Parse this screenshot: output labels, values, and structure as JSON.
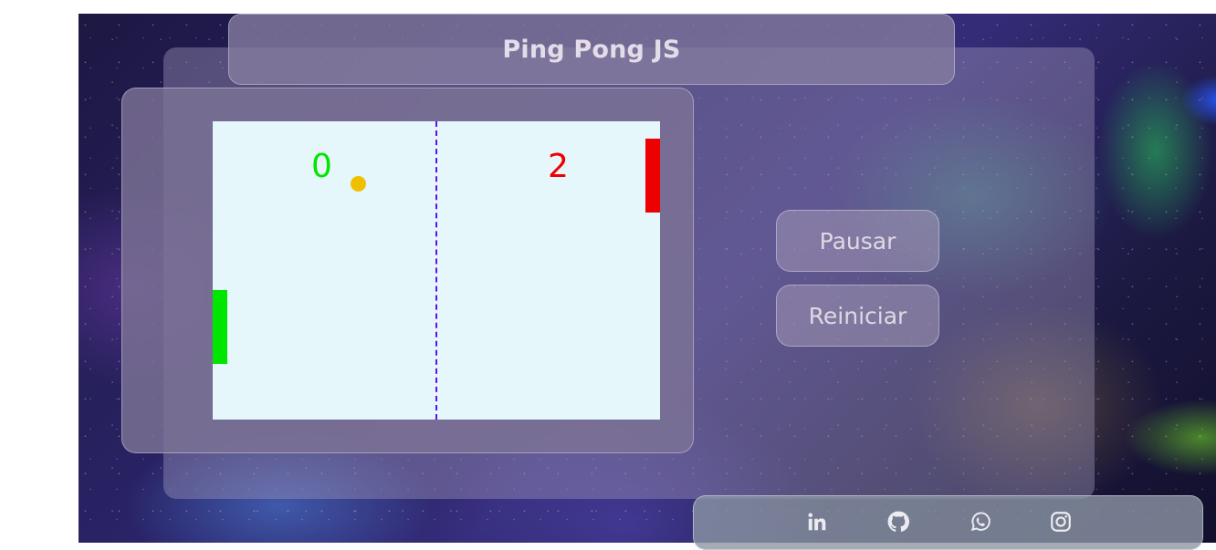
{
  "header": {
    "title": "Ping Pong JS"
  },
  "game": {
    "score_left": "0",
    "score_right": "2"
  },
  "controls": {
    "pause_label": "Pausar",
    "reset_label": "Reiniciar"
  },
  "footer": {
    "icons": [
      "linkedin-icon",
      "github-icon",
      "whatsapp-icon",
      "instagram-icon"
    ]
  },
  "colors": {
    "board": "#e6f7fc",
    "left_player": "#00e600",
    "right_player": "#ee0000",
    "ball": "#f0c000",
    "center_line": "#5a12f0",
    "icon": "#ececf0"
  }
}
